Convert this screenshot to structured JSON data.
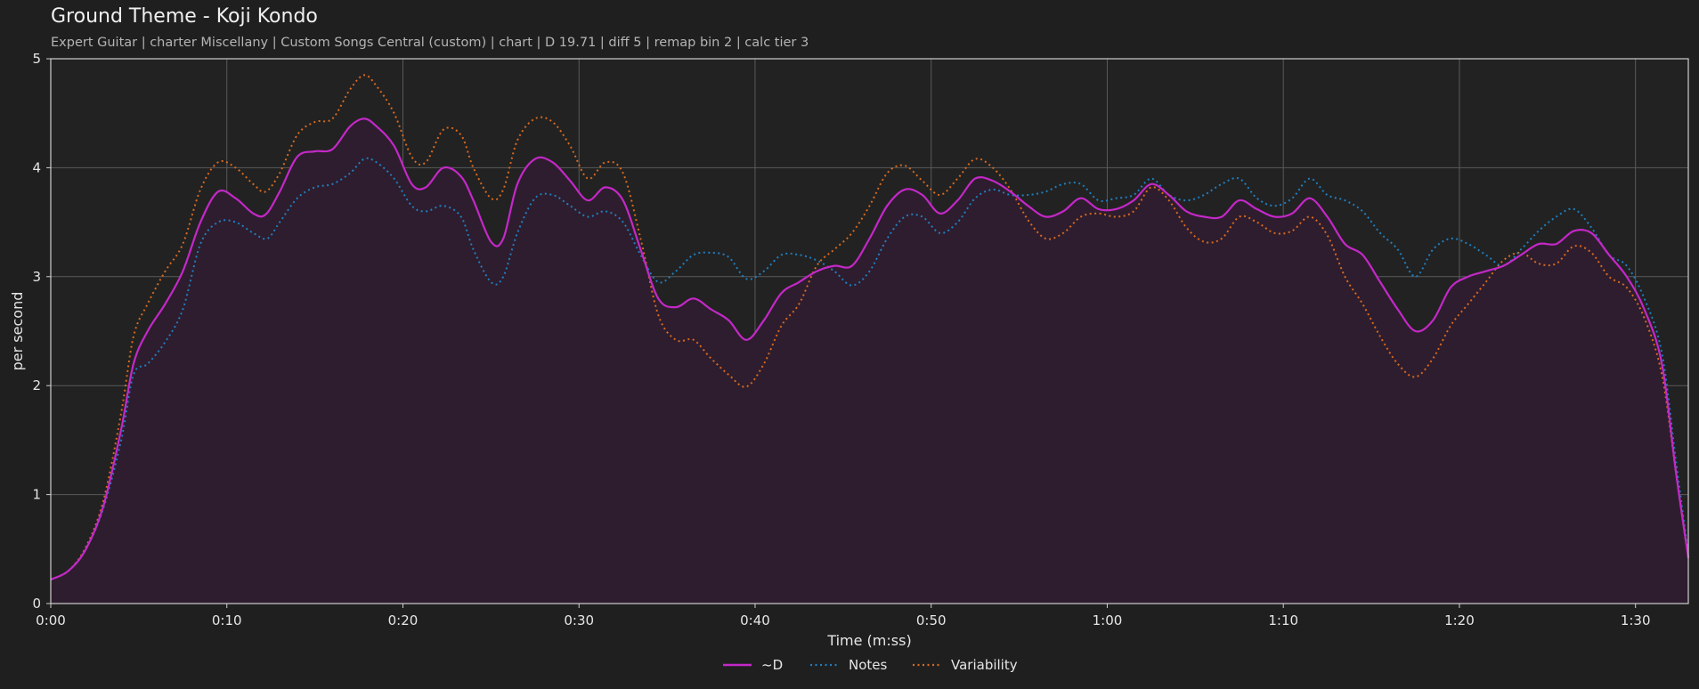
{
  "header": {
    "title": "Ground Theme - Koji Kondo",
    "subtitle": "Expert Guitar  |  charter Miscellany  |  Custom Songs Central (custom)  |  chart  |  D 19.71  |  diff 5  |  remap bin 2  |  calc tier 3"
  },
  "colors": {
    "background": "#1f1f1f",
    "plot_background": "#222222",
    "grid": "#5a5a5a",
    "spine": "#cfcfcf",
    "fill": "#2e1d2e",
    "d": "#c428c8",
    "notes": "#1f7fc0",
    "variability": "#d9691e"
  },
  "chart_data": {
    "type": "line",
    "xlabel": "Time (m:ss)",
    "ylabel": "per second",
    "xlim": [
      0,
      93
    ],
    "ylim": [
      0,
      5
    ],
    "x_unit": "seconds",
    "x_ticks": [
      {
        "value": 0,
        "label": "0:00"
      },
      {
        "value": 10,
        "label": "0:10"
      },
      {
        "value": 20,
        "label": "0:20"
      },
      {
        "value": 30,
        "label": "0:30"
      },
      {
        "value": 40,
        "label": "0:40"
      },
      {
        "value": 50,
        "label": "0:50"
      },
      {
        "value": 60,
        "label": "1:00"
      },
      {
        "value": 70,
        "label": "1:10"
      },
      {
        "value": 80,
        "label": "1:20"
      },
      {
        "value": 90,
        "label": "1:30"
      }
    ],
    "y_ticks": [
      0,
      1,
      2,
      3,
      4,
      5
    ],
    "grid": true,
    "legend": {
      "position": "bottom-center",
      "entries": [
        "~D",
        "Notes",
        "Variability"
      ]
    },
    "series": [
      {
        "name": "~D",
        "style": "solid",
        "color": "#c428c8",
        "filled": true,
        "points": [
          [
            0,
            0.22
          ],
          [
            1,
            0.3
          ],
          [
            2,
            0.5
          ],
          [
            3,
            0.9
          ],
          [
            4,
            1.6
          ],
          [
            4.7,
            2.2
          ],
          [
            5.5,
            2.5
          ],
          [
            6.5,
            2.75
          ],
          [
            7.5,
            3.05
          ],
          [
            8.5,
            3.5
          ],
          [
            9.5,
            3.78
          ],
          [
            10.5,
            3.72
          ],
          [
            11.5,
            3.58
          ],
          [
            12.2,
            3.57
          ],
          [
            13,
            3.78
          ],
          [
            14,
            4.1
          ],
          [
            15,
            4.15
          ],
          [
            16,
            4.17
          ],
          [
            17,
            4.38
          ],
          [
            17.8,
            4.45
          ],
          [
            18.5,
            4.38
          ],
          [
            19.5,
            4.2
          ],
          [
            20.5,
            3.85
          ],
          [
            21.3,
            3.82
          ],
          [
            22.3,
            4.0
          ],
          [
            23.3,
            3.92
          ],
          [
            24,
            3.7
          ],
          [
            25,
            3.32
          ],
          [
            25.7,
            3.35
          ],
          [
            26.5,
            3.85
          ],
          [
            27.5,
            4.08
          ],
          [
            28.5,
            4.05
          ],
          [
            29.5,
            3.88
          ],
          [
            30.5,
            3.7
          ],
          [
            31.5,
            3.82
          ],
          [
            32.5,
            3.7
          ],
          [
            33.5,
            3.25
          ],
          [
            34.5,
            2.8
          ],
          [
            35.5,
            2.72
          ],
          [
            36.5,
            2.8
          ],
          [
            37.5,
            2.7
          ],
          [
            38.5,
            2.6
          ],
          [
            39.5,
            2.42
          ],
          [
            40.5,
            2.6
          ],
          [
            41.5,
            2.85
          ],
          [
            42.5,
            2.95
          ],
          [
            43.5,
            3.05
          ],
          [
            44.5,
            3.1
          ],
          [
            45.5,
            3.1
          ],
          [
            46.5,
            3.35
          ],
          [
            47.5,
            3.65
          ],
          [
            48.5,
            3.8
          ],
          [
            49.5,
            3.75
          ],
          [
            50.5,
            3.58
          ],
          [
            51.5,
            3.7
          ],
          [
            52.5,
            3.9
          ],
          [
            53.5,
            3.88
          ],
          [
            54.5,
            3.78
          ],
          [
            55.5,
            3.65
          ],
          [
            56.5,
            3.55
          ],
          [
            57.5,
            3.6
          ],
          [
            58.5,
            3.72
          ],
          [
            59.5,
            3.62
          ],
          [
            60.5,
            3.62
          ],
          [
            61.5,
            3.7
          ],
          [
            62.5,
            3.85
          ],
          [
            63.5,
            3.75
          ],
          [
            64.5,
            3.6
          ],
          [
            65.5,
            3.55
          ],
          [
            66.5,
            3.55
          ],
          [
            67.5,
            3.7
          ],
          [
            68.5,
            3.62
          ],
          [
            69.5,
            3.55
          ],
          [
            70.5,
            3.58
          ],
          [
            71.5,
            3.72
          ],
          [
            72.5,
            3.55
          ],
          [
            73.5,
            3.3
          ],
          [
            74.5,
            3.2
          ],
          [
            75.5,
            2.95
          ],
          [
            76.5,
            2.7
          ],
          [
            77.5,
            2.5
          ],
          [
            78.5,
            2.6
          ],
          [
            79.5,
            2.9
          ],
          [
            80.5,
            3.0
          ],
          [
            81.5,
            3.05
          ],
          [
            82.5,
            3.1
          ],
          [
            83.5,
            3.2
          ],
          [
            84.5,
            3.3
          ],
          [
            85.5,
            3.3
          ],
          [
            86.5,
            3.42
          ],
          [
            87.5,
            3.4
          ],
          [
            88.5,
            3.2
          ],
          [
            89.5,
            3.0
          ],
          [
            90.5,
            2.7
          ],
          [
            91.5,
            2.2
          ],
          [
            92.3,
            1.2
          ],
          [
            93,
            0.42
          ]
        ]
      },
      {
        "name": "Notes",
        "style": "dotted",
        "color": "#1f7fc0",
        "points": [
          [
            0,
            0.22
          ],
          [
            1,
            0.3
          ],
          [
            2,
            0.5
          ],
          [
            3,
            0.88
          ],
          [
            4,
            1.5
          ],
          [
            4.7,
            2.1
          ],
          [
            5.5,
            2.2
          ],
          [
            6.5,
            2.4
          ],
          [
            7.5,
            2.7
          ],
          [
            8.5,
            3.3
          ],
          [
            9.5,
            3.5
          ],
          [
            10.5,
            3.5
          ],
          [
            11.5,
            3.4
          ],
          [
            12.3,
            3.35
          ],
          [
            13,
            3.5
          ],
          [
            14,
            3.72
          ],
          [
            15,
            3.82
          ],
          [
            16,
            3.85
          ],
          [
            17,
            3.95
          ],
          [
            17.8,
            4.08
          ],
          [
            18.5,
            4.05
          ],
          [
            19.5,
            3.9
          ],
          [
            20.5,
            3.65
          ],
          [
            21.3,
            3.6
          ],
          [
            22.3,
            3.65
          ],
          [
            23.3,
            3.55
          ],
          [
            24,
            3.25
          ],
          [
            25,
            2.95
          ],
          [
            25.7,
            3.0
          ],
          [
            26.5,
            3.4
          ],
          [
            27.5,
            3.72
          ],
          [
            28.5,
            3.75
          ],
          [
            29.5,
            3.65
          ],
          [
            30.5,
            3.55
          ],
          [
            31.5,
            3.6
          ],
          [
            32.5,
            3.5
          ],
          [
            33.5,
            3.2
          ],
          [
            34.5,
            2.95
          ],
          [
            35.5,
            3.05
          ],
          [
            36.5,
            3.2
          ],
          [
            37.5,
            3.22
          ],
          [
            38.5,
            3.18
          ],
          [
            39.5,
            2.98
          ],
          [
            40.5,
            3.05
          ],
          [
            41.5,
            3.2
          ],
          [
            42.5,
            3.2
          ],
          [
            43.5,
            3.15
          ],
          [
            44.5,
            3.05
          ],
          [
            45.5,
            2.92
          ],
          [
            46.5,
            3.05
          ],
          [
            47.5,
            3.35
          ],
          [
            48.5,
            3.55
          ],
          [
            49.5,
            3.55
          ],
          [
            50.5,
            3.4
          ],
          [
            51.5,
            3.5
          ],
          [
            52.5,
            3.72
          ],
          [
            53.5,
            3.8
          ],
          [
            54.5,
            3.75
          ],
          [
            55.5,
            3.75
          ],
          [
            56.5,
            3.78
          ],
          [
            57.5,
            3.85
          ],
          [
            58.5,
            3.85
          ],
          [
            59.5,
            3.7
          ],
          [
            60.5,
            3.72
          ],
          [
            61.5,
            3.75
          ],
          [
            62.5,
            3.9
          ],
          [
            63.5,
            3.75
          ],
          [
            64.5,
            3.7
          ],
          [
            65.5,
            3.75
          ],
          [
            66.5,
            3.85
          ],
          [
            67.5,
            3.9
          ],
          [
            68.5,
            3.72
          ],
          [
            69.5,
            3.65
          ],
          [
            70.5,
            3.72
          ],
          [
            71.5,
            3.9
          ],
          [
            72.5,
            3.75
          ],
          [
            73.5,
            3.7
          ],
          [
            74.5,
            3.6
          ],
          [
            75.5,
            3.4
          ],
          [
            76.5,
            3.25
          ],
          [
            77.5,
            3.0
          ],
          [
            78.5,
            3.25
          ],
          [
            79.5,
            3.35
          ],
          [
            80.5,
            3.3
          ],
          [
            81.5,
            3.2
          ],
          [
            82.5,
            3.1
          ],
          [
            83.5,
            3.25
          ],
          [
            84.5,
            3.42
          ],
          [
            85.5,
            3.55
          ],
          [
            86.5,
            3.62
          ],
          [
            87.5,
            3.45
          ],
          [
            88.5,
            3.2
          ],
          [
            89.5,
            3.1
          ],
          [
            90.5,
            2.8
          ],
          [
            91.5,
            2.3
          ],
          [
            92.3,
            1.3
          ],
          [
            93,
            0.45
          ]
        ]
      },
      {
        "name": "Variability",
        "style": "dotted",
        "color": "#d9691e",
        "points": [
          [
            0,
            0.22
          ],
          [
            1,
            0.3
          ],
          [
            2,
            0.52
          ],
          [
            3,
            0.95
          ],
          [
            4,
            1.75
          ],
          [
            4.7,
            2.45
          ],
          [
            5.5,
            2.75
          ],
          [
            6.5,
            3.05
          ],
          [
            7.5,
            3.3
          ],
          [
            8.5,
            3.8
          ],
          [
            9.5,
            4.05
          ],
          [
            10.5,
            4.0
          ],
          [
            11.5,
            3.85
          ],
          [
            12.2,
            3.78
          ],
          [
            13,
            3.95
          ],
          [
            14,
            4.3
          ],
          [
            15,
            4.42
          ],
          [
            16,
            4.45
          ],
          [
            17,
            4.72
          ],
          [
            17.8,
            4.85
          ],
          [
            18.5,
            4.75
          ],
          [
            19.5,
            4.5
          ],
          [
            20.5,
            4.1
          ],
          [
            21.3,
            4.05
          ],
          [
            22.3,
            4.35
          ],
          [
            23.3,
            4.3
          ],
          [
            24,
            4.0
          ],
          [
            25,
            3.72
          ],
          [
            25.7,
            3.8
          ],
          [
            26.5,
            4.25
          ],
          [
            27.5,
            4.45
          ],
          [
            28.5,
            4.42
          ],
          [
            29.5,
            4.2
          ],
          [
            30.5,
            3.9
          ],
          [
            31.5,
            4.05
          ],
          [
            32.5,
            3.95
          ],
          [
            33.5,
            3.35
          ],
          [
            34.5,
            2.65
          ],
          [
            35.5,
            2.42
          ],
          [
            36.5,
            2.42
          ],
          [
            37.5,
            2.25
          ],
          [
            38.5,
            2.1
          ],
          [
            39.5,
            1.99
          ],
          [
            40.5,
            2.2
          ],
          [
            41.5,
            2.55
          ],
          [
            42.5,
            2.75
          ],
          [
            43.5,
            3.1
          ],
          [
            44.5,
            3.25
          ],
          [
            45.5,
            3.4
          ],
          [
            46.5,
            3.65
          ],
          [
            47.5,
            3.95
          ],
          [
            48.5,
            4.02
          ],
          [
            49.5,
            3.88
          ],
          [
            50.5,
            3.75
          ],
          [
            51.5,
            3.9
          ],
          [
            52.5,
            4.08
          ],
          [
            53.5,
            4.0
          ],
          [
            54.5,
            3.8
          ],
          [
            55.5,
            3.52
          ],
          [
            56.5,
            3.35
          ],
          [
            57.5,
            3.4
          ],
          [
            58.5,
            3.55
          ],
          [
            59.5,
            3.58
          ],
          [
            60.5,
            3.55
          ],
          [
            61.5,
            3.6
          ],
          [
            62.5,
            3.82
          ],
          [
            63.5,
            3.7
          ],
          [
            64.5,
            3.45
          ],
          [
            65.5,
            3.32
          ],
          [
            66.5,
            3.35
          ],
          [
            67.5,
            3.55
          ],
          [
            68.5,
            3.5
          ],
          [
            69.5,
            3.4
          ],
          [
            70.5,
            3.42
          ],
          [
            71.5,
            3.55
          ],
          [
            72.5,
            3.38
          ],
          [
            73.5,
            3.0
          ],
          [
            74.5,
            2.75
          ],
          [
            75.5,
            2.45
          ],
          [
            76.5,
            2.2
          ],
          [
            77.5,
            2.08
          ],
          [
            78.5,
            2.25
          ],
          [
            79.5,
            2.55
          ],
          [
            80.5,
            2.75
          ],
          [
            81.5,
            2.95
          ],
          [
            82.5,
            3.15
          ],
          [
            83.5,
            3.22
          ],
          [
            84.5,
            3.12
          ],
          [
            85.5,
            3.12
          ],
          [
            86.5,
            3.28
          ],
          [
            87.5,
            3.22
          ],
          [
            88.5,
            3.0
          ],
          [
            89.5,
            2.9
          ],
          [
            90.5,
            2.62
          ],
          [
            91.5,
            2.1
          ],
          [
            92.3,
            1.2
          ],
          [
            93,
            0.42
          ]
        ]
      }
    ]
  }
}
